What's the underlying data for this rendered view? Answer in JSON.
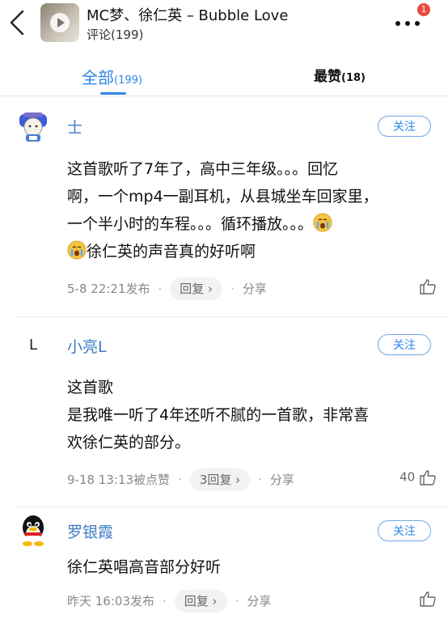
{
  "header": {
    "title": "MC梦、徐仁英 – Bubble Love",
    "subtitle": "评论(199)",
    "notification_count": "1"
  },
  "tabs": {
    "all_label": "全部",
    "all_count": "(199)",
    "best_label": "最赞",
    "best_count": "(18)"
  },
  "comments": [
    {
      "username": "士",
      "follow_label": "关注",
      "text_lines": [
        "这首歌听了7年了，高中三年级。。。回忆",
        "啊，一个mp4一副耳机，从县城坐车回家里，",
        "一个半小时的车程。。。循环播放。。。",
        "徐仁英的声音真的好听啊"
      ],
      "time": "5-8 22:21发布",
      "reply_label": "回复 ›",
      "share_label": "分享",
      "likes": ""
    },
    {
      "username": "小亮L",
      "avatar_text": "L",
      "follow_label": "关注",
      "text_lines": [
        "这首歌",
        "是我唯一听了4年还听不腻的一首歌，非常喜",
        "欢徐仁英的部分。"
      ],
      "time": "9-18 13:13被点赞",
      "reply_label": "3回复 ›",
      "share_label": "分享",
      "likes": "40"
    },
    {
      "username": "罗银霞",
      "follow_label": "关注",
      "text_lines": [
        "徐仁英唱高音部分好听"
      ],
      "time": "昨天 16:03发布",
      "reply_label": "回复 ›",
      "share_label": "分享",
      "likes": ""
    }
  ],
  "colors": {
    "accent": "#2e86e8",
    "username": "#3d7bc4",
    "badge": "#e84a3f"
  }
}
